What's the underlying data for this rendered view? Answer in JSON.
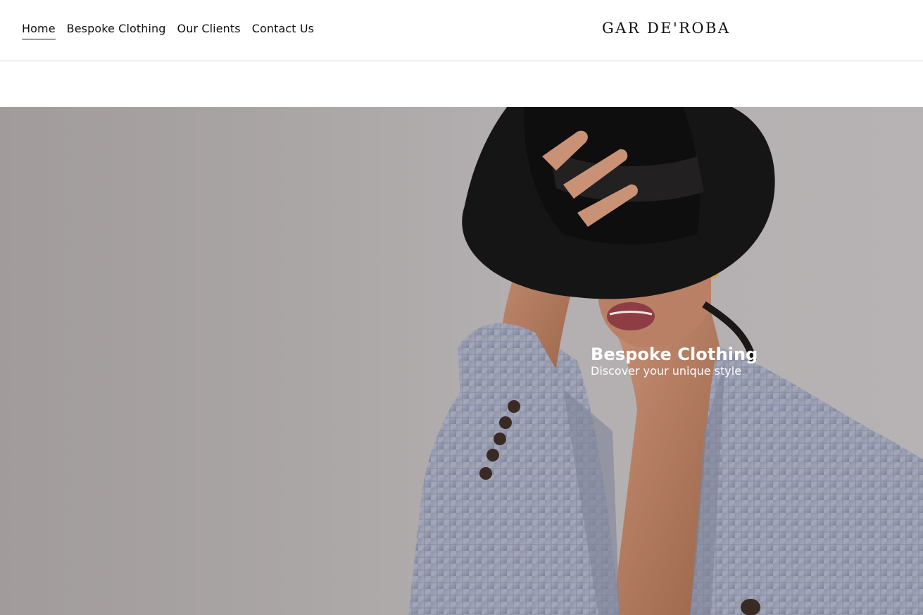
{
  "header": {
    "nav": [
      {
        "label": "Home",
        "active": true
      },
      {
        "label": "Bespoke Clothing",
        "active": false
      },
      {
        "label": "Our Clients",
        "active": false
      },
      {
        "label": "Contact Us",
        "active": false
      }
    ],
    "brand": "GAR DE'ROBA"
  },
  "hero": {
    "title": "Bespoke Clothing",
    "subtitle": "Discover your unique style",
    "image": "woman-in-black-fedora-and-plaid-blazer"
  },
  "colors": {
    "background": "#ffffff",
    "hero_backdrop": "#aaa5a5",
    "text_dark": "#111111",
    "hero_text": "#ffffff"
  }
}
